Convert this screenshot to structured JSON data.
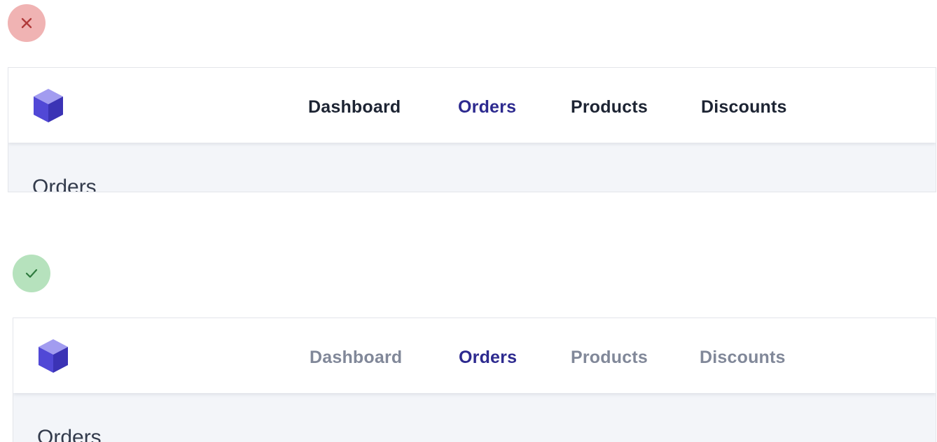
{
  "badges": {
    "bad": {
      "icon": "x-icon",
      "background": "#f0b3b3",
      "color": "#b03a3a"
    },
    "good": {
      "icon": "check-icon",
      "background": "#b6e2bd",
      "color": "#2f7a3f"
    }
  },
  "examples": [
    {
      "variant": "incorrect",
      "logo": "cube-logo-icon",
      "nav": [
        "Dashboard",
        "Orders",
        "Products",
        "Discounts"
      ],
      "active": "Orders",
      "inactive_color": "#1d2433",
      "active_color": "#2d2a8f",
      "heading": "Orders"
    },
    {
      "variant": "correct",
      "logo": "cube-logo-icon",
      "nav": [
        "Dashboard",
        "Orders",
        "Products",
        "Discounts"
      ],
      "active": "Orders",
      "inactive_color": "#818899",
      "active_color": "#2d2a8f",
      "heading": "Orders"
    }
  ]
}
